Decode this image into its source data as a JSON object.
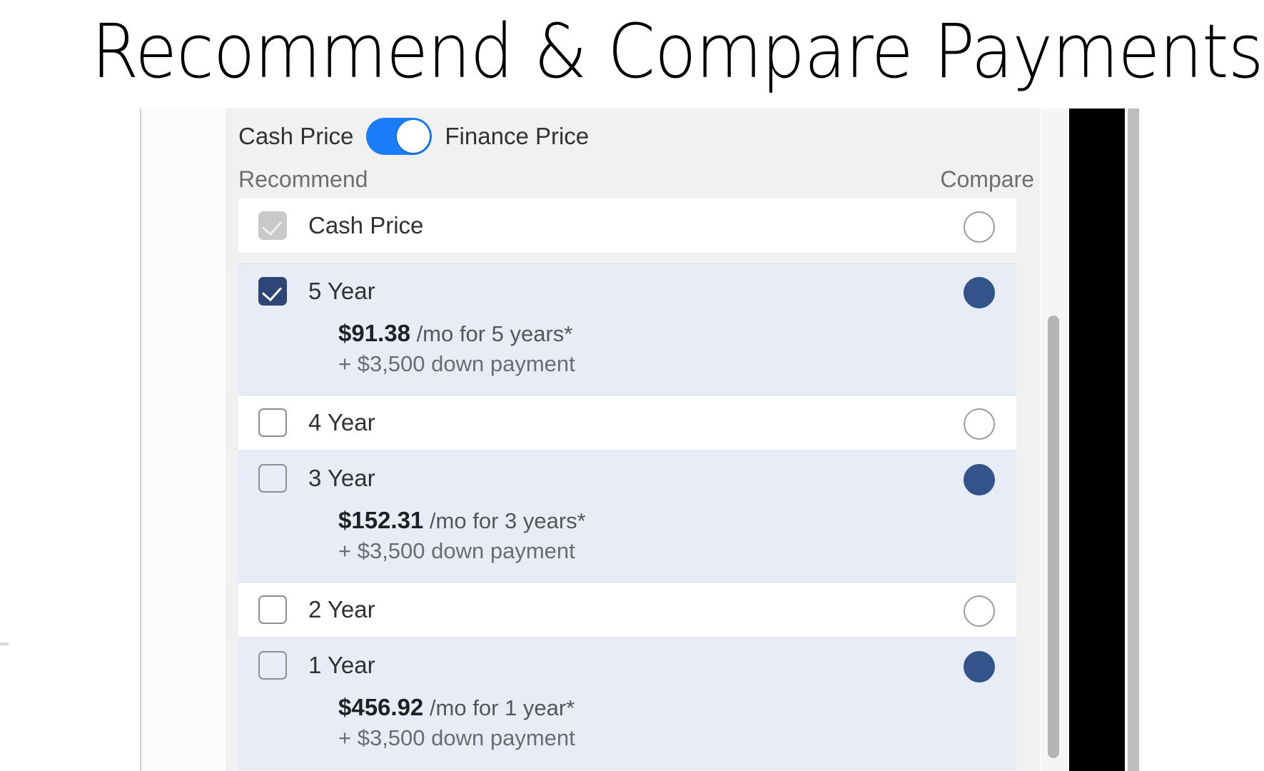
{
  "slide": {
    "title": "Recommend & Compare Payments"
  },
  "toggle": {
    "left_label": "Cash Price",
    "right_label": "Finance Price",
    "state": "on",
    "accent_color": "#1a7cf7",
    "knob_color": "#ffffff"
  },
  "captions": {
    "recommend": "Recommend",
    "compare": "Compare"
  },
  "colors": {
    "checked_checkbox": "#2f4576",
    "disabled_checkbox": "#c9c9c9",
    "radio_on": "#34538a",
    "row_tint": "#e7ecf6",
    "row_plain": "#ffffff",
    "header_bg": "#f1f1f1"
  },
  "options": [
    {
      "name": "Cash Price",
      "checkbox_state": "checked-disabled",
      "compare_state": "off",
      "row_style": "plain",
      "has_details": false,
      "payment": "",
      "payment_suffix": "",
      "down_payment": ""
    },
    {
      "name": "5 Year",
      "checkbox_state": "checked",
      "compare_state": "on",
      "row_style": "tinted",
      "has_details": true,
      "payment": "$91.38",
      "payment_suffix": "/mo for 5 years*",
      "down_payment": "+ $3,500 down payment"
    },
    {
      "name": "4 Year",
      "checkbox_state": "unchecked",
      "compare_state": "off",
      "row_style": "plain",
      "has_details": false,
      "payment": "",
      "payment_suffix": "",
      "down_payment": ""
    },
    {
      "name": "3 Year",
      "checkbox_state": "unchecked",
      "compare_state": "on",
      "row_style": "tinted",
      "has_details": true,
      "payment": "$152.31",
      "payment_suffix": "/mo for 3 years*",
      "down_payment": "+ $3,500 down payment"
    },
    {
      "name": "2 Year",
      "checkbox_state": "unchecked",
      "compare_state": "off",
      "row_style": "plain",
      "has_details": false,
      "payment": "",
      "payment_suffix": "",
      "down_payment": ""
    },
    {
      "name": "1 Year",
      "checkbox_state": "unchecked",
      "compare_state": "on",
      "row_style": "tinted",
      "has_details": true,
      "payment": "$456.92",
      "payment_suffix": "/mo for 1 year*",
      "down_payment": "+ $3,500 down payment"
    }
  ]
}
